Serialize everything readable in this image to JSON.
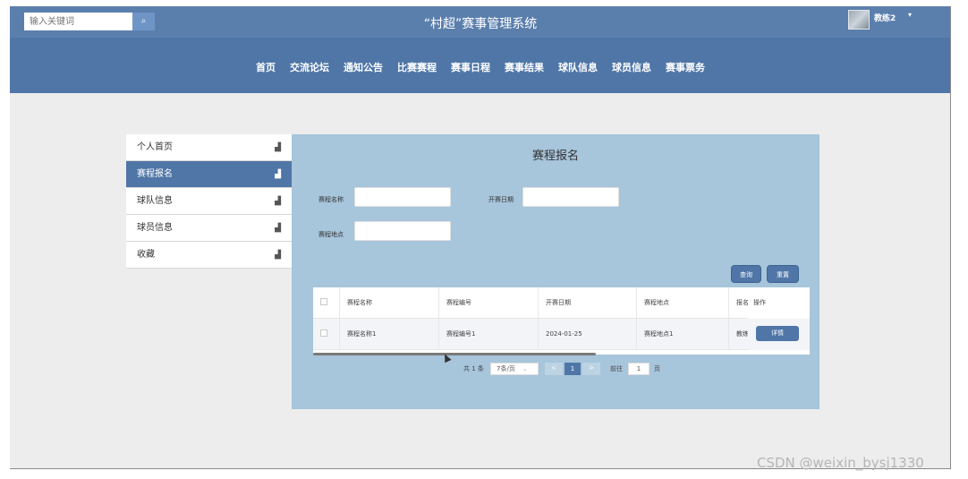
{
  "header": {
    "search_placeholder": "输入关键词",
    "site_title": "“村超”赛事管理系统",
    "user_name": "教练2",
    "user_caret": "▾"
  },
  "nav": {
    "items": [
      "首页",
      "交流论坛",
      "通知公告",
      "比赛赛程",
      "赛事日程",
      "赛事结果",
      "球队信息",
      "球员信息",
      "赛事票务"
    ]
  },
  "sidebar": {
    "items": [
      {
        "label": "个人首页",
        "active": false
      },
      {
        "label": "赛程报名",
        "active": true
      },
      {
        "label": "球队信息",
        "active": false
      },
      {
        "label": "球员信息",
        "active": false
      },
      {
        "label": "收藏",
        "active": false
      }
    ]
  },
  "panel": {
    "title": "赛程报名",
    "filters": {
      "name_label": "赛程名称",
      "date_label": "开赛日期",
      "location_label": "赛程地点"
    },
    "query_button": "查询",
    "reset_button": "重置"
  },
  "table": {
    "headers": [
      "赛程名称",
      "赛程编号",
      "开赛日期",
      "赛程地点",
      "报名",
      "操作"
    ],
    "rows": [
      {
        "name": "赛程名称1",
        "code": "赛程编号1",
        "date": "2024-01-25",
        "location": "赛程地点1",
        "signup": "教练2",
        "action": "详情"
      }
    ]
  },
  "pager": {
    "total": "共 1 条",
    "page_size": "7条/页",
    "prev": "<",
    "current": "1",
    "next": ">",
    "goto_label": "前往",
    "goto_value": "1",
    "page_suffix": "页"
  },
  "watermark": "CSDN @weixin_bysj1330",
  "colors": {
    "topbar": "#5b7fad",
    "nav": "#4f76a7",
    "panel": "#a7c5db",
    "accent": "#4f76a7"
  }
}
